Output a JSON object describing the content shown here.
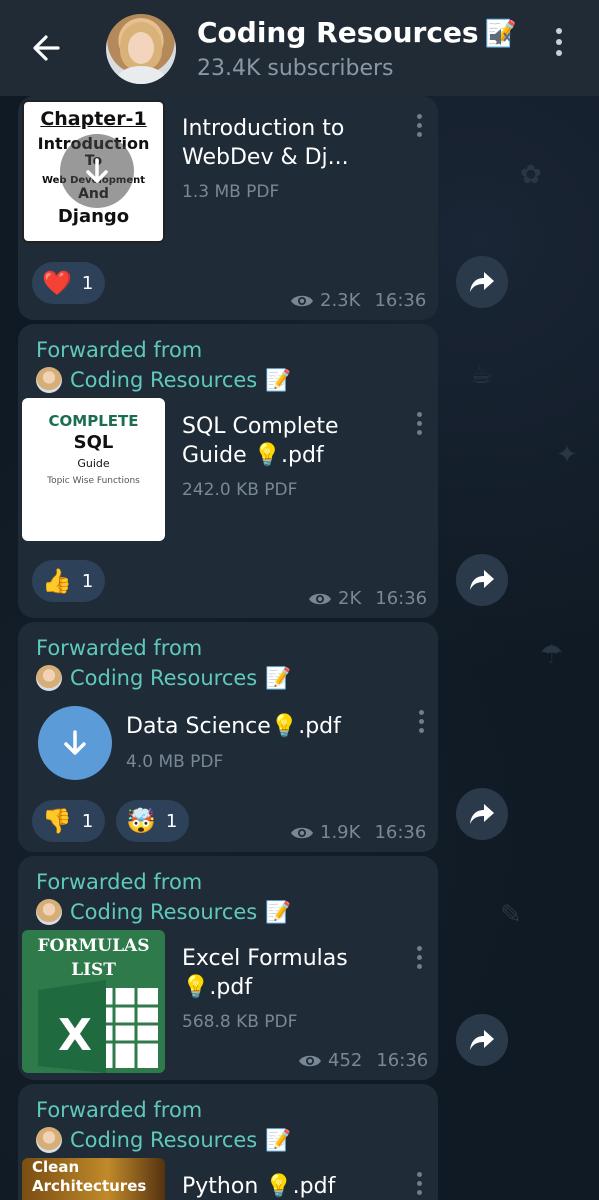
{
  "header": {
    "title": "Coding Resources",
    "title_emoji": "📝",
    "subtitle": "23.4K subscribers"
  },
  "messages": [
    {
      "thumb_lines": [
        "Chapter-1",
        "Introduction",
        "To",
        "Web Development",
        "And",
        "Django"
      ],
      "title": "Introduction to WebDev & Dj...",
      "size": "1.3 MB PDF",
      "reactions": [
        {
          "emoji": "❤️",
          "count": "1"
        }
      ],
      "views": "2.3K",
      "time": "16:36"
    },
    {
      "forwarded_label": "Forwarded from",
      "forwarded_from": "Coding Resources",
      "forwarded_emoji": "📝",
      "thumb_lines": [
        "COMPLETE",
        "SQL",
        "Guide",
        "Topic Wise Functions"
      ],
      "title": "SQL Complete Guide 💡.pdf",
      "size": "242.0 KB PDF",
      "reactions": [
        {
          "emoji": "👍",
          "count": "1"
        }
      ],
      "views": "2K",
      "time": "16:36"
    },
    {
      "forwarded_label": "Forwarded from",
      "forwarded_from": "Coding Resources",
      "forwarded_emoji": "📝",
      "title": "Data Science💡.pdf",
      "size": "4.0 MB PDF",
      "reactions": [
        {
          "emoji": "👎",
          "count": "1"
        },
        {
          "emoji": "🤯",
          "count": "1"
        }
      ],
      "views": "1.9K",
      "time": "16:36"
    },
    {
      "forwarded_label": "Forwarded from",
      "forwarded_from": "Coding Resources",
      "forwarded_emoji": "📝",
      "thumb_lines": [
        "FORMULAS",
        "LIST"
      ],
      "title": "Excel Formulas 💡.pdf",
      "size": "568.8 KB PDF",
      "views": "452",
      "time": "16:36"
    },
    {
      "forwarded_label": "Forwarded from",
      "forwarded_from": "Coding Resources",
      "forwarded_emoji": "📝",
      "thumb_lines": [
        "Clean",
        "Architectures"
      ],
      "title": "Python 💡.pdf"
    }
  ]
}
